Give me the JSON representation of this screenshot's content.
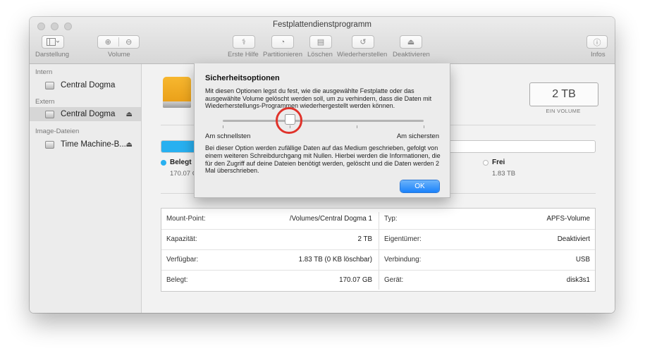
{
  "window": {
    "title": "Festplattendienstprogramm"
  },
  "toolbar": {
    "darstellung": "Darstellung",
    "volume": "Volume",
    "erste_hilfe": "Erste Hilfe",
    "partitionieren": "Partitionieren",
    "loeschen": "Löschen",
    "wiederherstellen": "Wiederherstellen",
    "deaktivieren": "Deaktivieren",
    "infos": "Infos"
  },
  "sidebar": {
    "sections": [
      {
        "title": "Intern",
        "items": [
          {
            "label": "Central Dogma"
          }
        ]
      },
      {
        "title": "Extern",
        "items": [
          {
            "label": "Central Dogma",
            "selected": true
          }
        ]
      },
      {
        "title": "Image-Dateien",
        "items": [
          {
            "label": "Time Machine-B..."
          }
        ]
      }
    ]
  },
  "drive": {
    "capacity": "2 TB",
    "capacity_label": "EIN VOLUME"
  },
  "usage": {
    "used_fraction": 0.085,
    "used_label": "Belegt",
    "used_value": "170.07 G",
    "free_label": "Frei",
    "free_value": "1.83 TB",
    "used_color": "#28b0f0"
  },
  "info": {
    "rows": [
      {
        "label": "Mount-Point:",
        "value": "/Volumes/Central Dogma 1",
        "label2": "Typ:",
        "value2": "APFS-Volume"
      },
      {
        "label": "Kapazität:",
        "value": "2 TB",
        "label2": "Eigentümer:",
        "value2": "Deaktiviert"
      },
      {
        "label": "Verfügbar:",
        "value": "1.83 TB (0 KB löschbar)",
        "label2": "Verbindung:",
        "value2": "USB"
      },
      {
        "label": "Belegt:",
        "value": "170.07 GB",
        "label2": "Gerät:",
        "value2": "disk3s1"
      }
    ]
  },
  "sheet": {
    "title": "Sicherheitsoptionen",
    "description": "Mit diesen Optionen legst du fest, wie die ausgewählte Festplatte oder das ausgewählte Volume gelöscht werden soll, um zu verhindern, dass die Daten mit Wiederherstellungs-Programmen wiederhergestellt werden können.",
    "slider_left": "Am schnellsten",
    "slider_right": "Am sichersten",
    "slider_position": 0.333,
    "slider_steps": 4,
    "body": "Bei dieser Option werden zufällige Daten auf das Medium geschrieben, gefolgt von einem weiteren Schreibdurchgang mit Nullen. Hierbei werden die Informationen, die für den Zugriff auf deine Dateien benötigt werden, gelöscht und die Daten werden 2 Mal überschrieben.",
    "ok": "OK"
  },
  "colors": {
    "accent": "#1a82fb",
    "highlight": "#e0332b"
  }
}
